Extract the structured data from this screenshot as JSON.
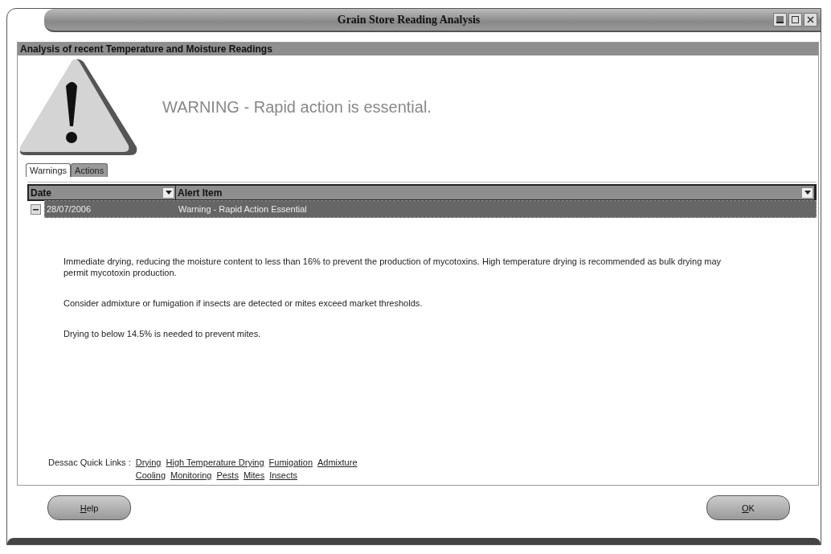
{
  "window": {
    "title": "Grain Store Reading Analysis"
  },
  "panel": {
    "title": "Analysis of recent Temperature and Moisture Readings"
  },
  "headline": "WARNING - Rapid action is essential.",
  "tabs": [
    {
      "label": "Warnings",
      "selected": true
    },
    {
      "label": "Actions",
      "selected": false
    }
  ],
  "table": {
    "columns": [
      "Date",
      "Alert Item"
    ],
    "rows": [
      {
        "cells": [
          "28/07/2006",
          "Warning - Rapid Action Essential"
        ],
        "expanded": true,
        "selected": true
      }
    ]
  },
  "paragraphs": [
    "Immediate drying, reducing the moisture content to less than 16% to prevent the production of mycotoxins. High temperature drying is recommended as bulk drying may permit mycotoxin production.",
    "Consider admixture or fumigation if insects are detected or mites exceed market thresholds.",
    "Drying to below 14.5% is needed to prevent mites."
  ],
  "quick_links": {
    "label": "Dessac Quick Links :",
    "links": [
      "Drying",
      "High Temperature Drying",
      "Fumigation",
      "Admixture",
      "Cooling",
      "Monitoring",
      "Pests",
      "Mites",
      "Insects"
    ]
  },
  "buttons": [
    "Help",
    "OK"
  ]
}
